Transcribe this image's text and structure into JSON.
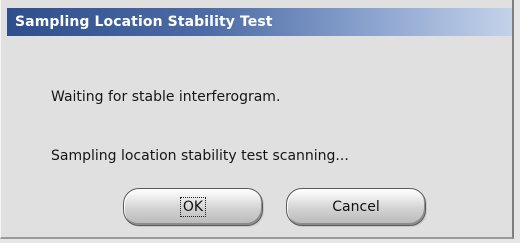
{
  "window": {
    "title": "Sampling Location Stability Test"
  },
  "messages": {
    "line1": "Waiting for stable interferogram.",
    "line2": "Sampling location stability test scanning..."
  },
  "buttons": {
    "ok_label": "OK",
    "cancel_label": "Cancel"
  },
  "colors": {
    "titlebar_start": "#2e4f8c",
    "titlebar_end": "#c4d2ea",
    "dialog_background": "#e0e0e0"
  }
}
